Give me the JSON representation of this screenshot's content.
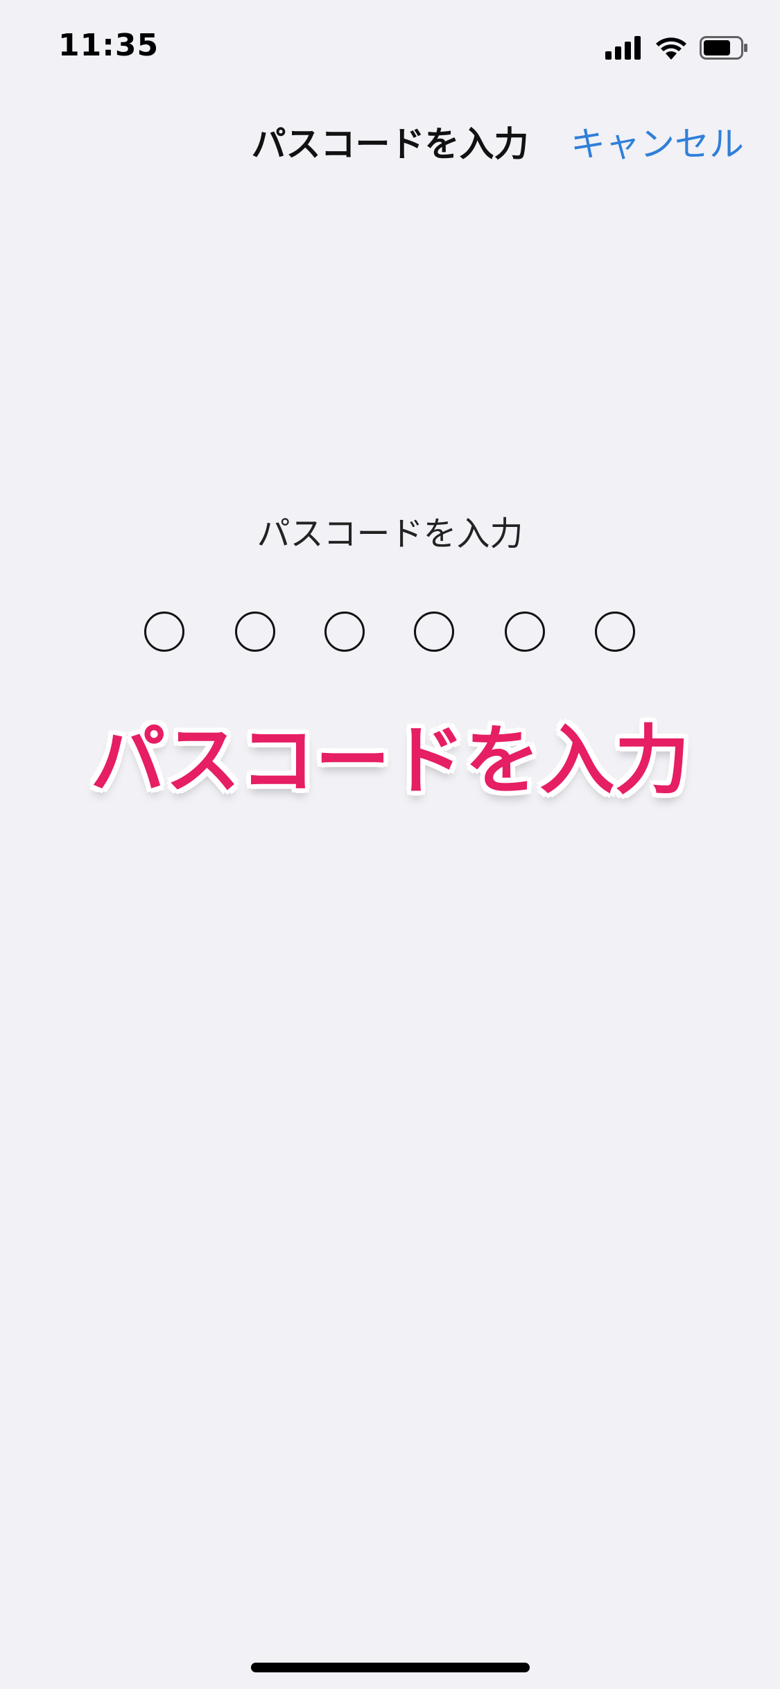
{
  "status_bar": {
    "time": "11:35",
    "icons": [
      "cellular-signal-icon",
      "wifi-icon",
      "battery-icon"
    ]
  },
  "nav": {
    "title": "パスコードを入力",
    "cancel_label": "キャンセル"
  },
  "passcode": {
    "prompt": "パスコードを入力",
    "digits_total": 6,
    "digits_entered": 0
  },
  "overlay": {
    "caption": "パスコードを入力"
  },
  "colors": {
    "background": "#f1f1f6",
    "accent": "#2f7fd8",
    "caption": "#e61e63"
  }
}
